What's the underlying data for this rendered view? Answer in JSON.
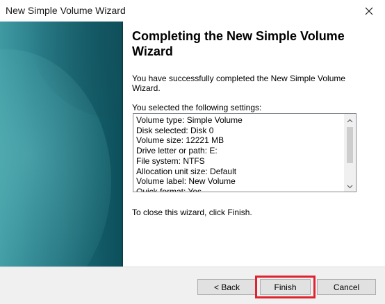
{
  "window": {
    "title": "New Simple Volume Wizard",
    "close_icon": "close-icon"
  },
  "content": {
    "heading": "Completing the New Simple Volume Wizard",
    "intro": "You have successfully completed the New Simple Volume Wizard.",
    "settings_label": "You selected the following settings:",
    "settings": [
      "Volume type: Simple Volume",
      "Disk selected: Disk 0",
      "Volume size: 12221 MB",
      "Drive letter or path: E:",
      "File system: NTFS",
      "Allocation unit size: Default",
      "Volume label: New Volume",
      "Quick format: Yes"
    ],
    "close_hint": "To close this wizard, click Finish."
  },
  "buttons": {
    "back": "< Back",
    "finish": "Finish",
    "cancel": "Cancel"
  },
  "colors": {
    "highlight": "#e0212e",
    "side_panel": "#1f6d79"
  }
}
